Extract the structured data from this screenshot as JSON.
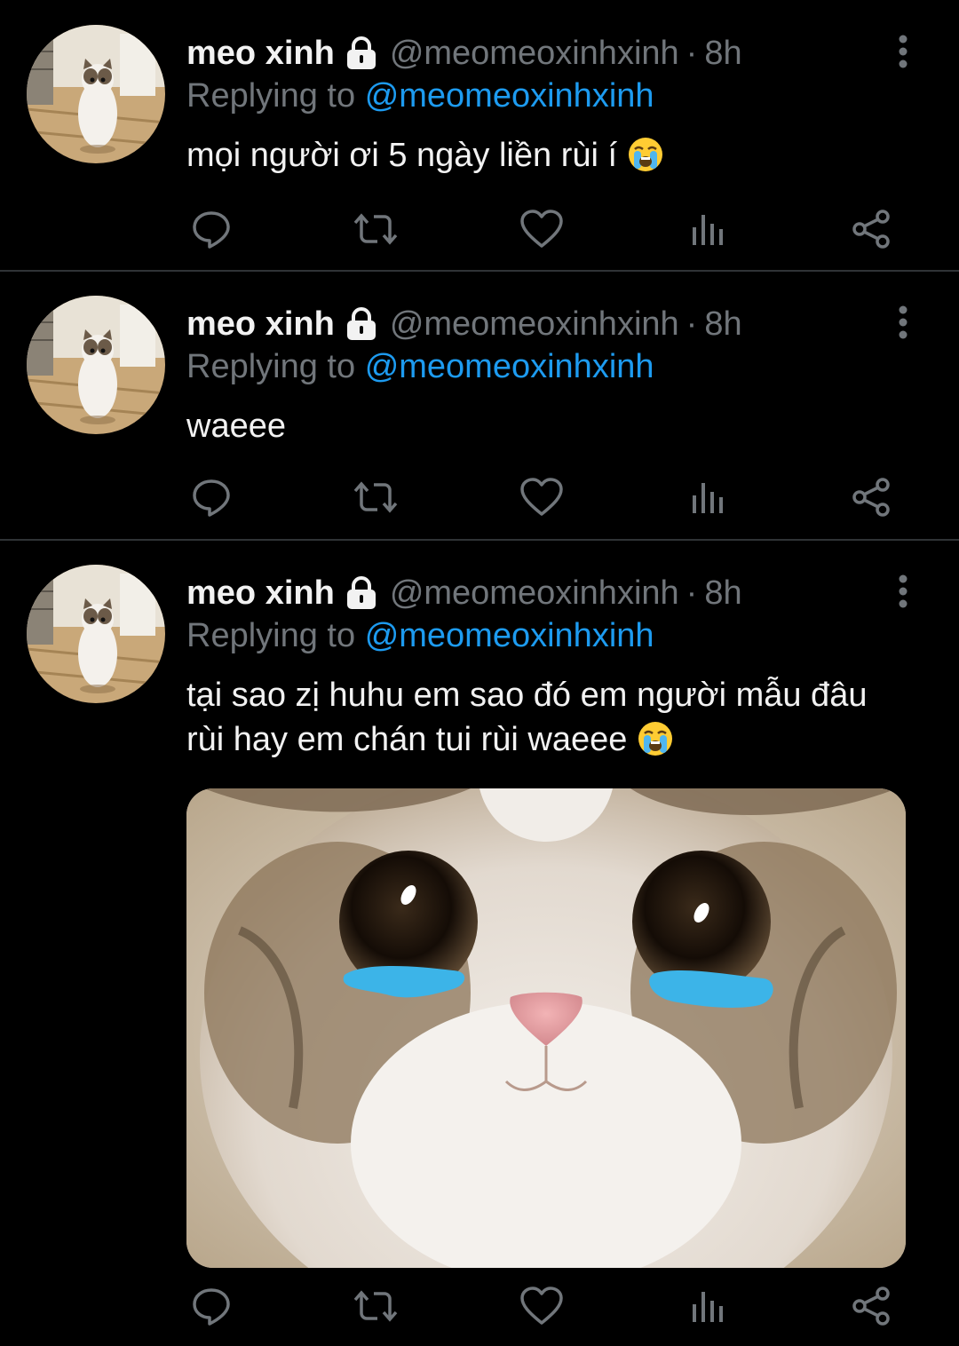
{
  "colors": {
    "background": "#000000",
    "text": "#e7e9ea",
    "secondary": "#71767b",
    "accent": "#1d9bf0",
    "divider": "#2f3336"
  },
  "tweets": [
    {
      "name": "meo xinh",
      "handle": "@meomeoxinhxinh",
      "separator": "·",
      "time": "8h",
      "replying_prefix": "Replying to",
      "replying_to": "@meomeoxinhxinh",
      "text": "mọi người ơi 5 ngày liền rùi í",
      "emoji": "loudly-crying-face",
      "has_media": false
    },
    {
      "name": "meo xinh",
      "handle": "@meomeoxinhxinh",
      "separator": "·",
      "time": "8h",
      "replying_prefix": "Replying to",
      "replying_to": "@meomeoxinhxinh",
      "text": "waeee",
      "has_media": false
    },
    {
      "name": "meo xinh",
      "handle": "@meomeoxinhxinh",
      "separator": "·",
      "time": "8h",
      "replying_prefix": "Replying to",
      "replying_to": "@meomeoxinhxinh",
      "text": "tại sao zị huhu em sao đó em người mẫu đâu rùi hay em chán tui rùi waeee",
      "emoji": "loudly-crying-face",
      "has_media": true,
      "media_subject": "crying-cat-photo"
    }
  ],
  "icons": {
    "lock": "lock-icon",
    "more": "more-vertical-icon",
    "reply": "reply-icon",
    "retweet": "retweet-icon",
    "like": "heart-icon",
    "views": "analytics-icon",
    "share": "share-icon"
  }
}
